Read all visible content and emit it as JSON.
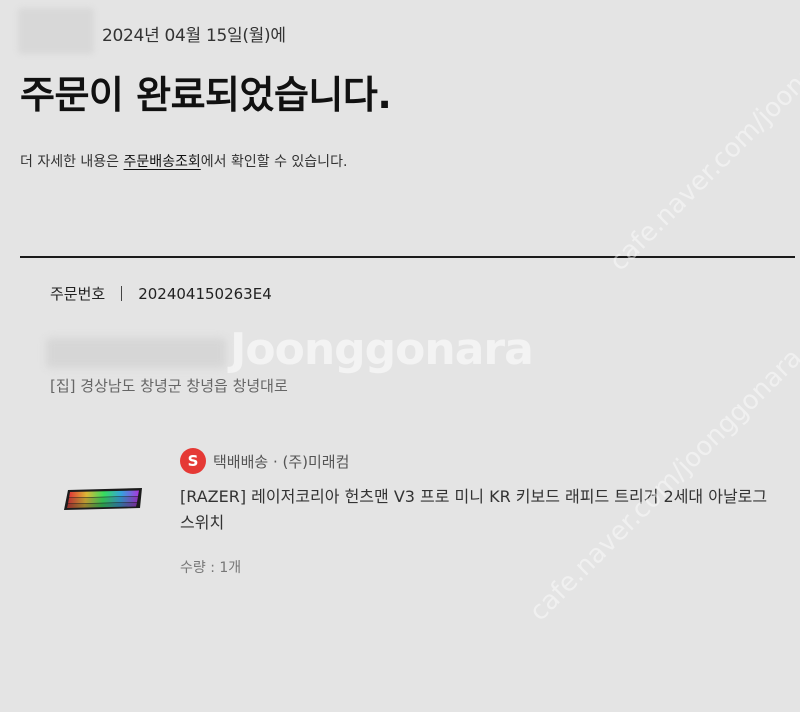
{
  "header": {
    "date_line": "2024년 04월 15일(월)에",
    "headline": "주문이 완료되었습니다.",
    "sub_prefix": "더 자세한 내용은 ",
    "sub_link": "주문배송조회",
    "sub_suffix": "에서 확인할 수 있습니다."
  },
  "order": {
    "label": "주문번호",
    "number": "202404150263E4"
  },
  "shipping": {
    "address": "[집] 경상남도 창녕군 창녕읍 창녕대로"
  },
  "item": {
    "badge": "S",
    "shipper": "택배배송 · (주)미래컴",
    "title": "[RAZER] 레이저코리아 헌츠맨 V3 프로 미니 KR 키보드 래피드 트리거 2세대 아날로그 스위치",
    "quantity": "수량 : 1개",
    "thumb_icon": "keyboard-icon"
  },
  "watermark": {
    "logo": "Joonggonara",
    "diag": "cafe.naver.com/joonggonara"
  },
  "colors": {
    "background": "#e4e4e4",
    "badge": "#e53935",
    "divider": "#1a1a1a"
  }
}
